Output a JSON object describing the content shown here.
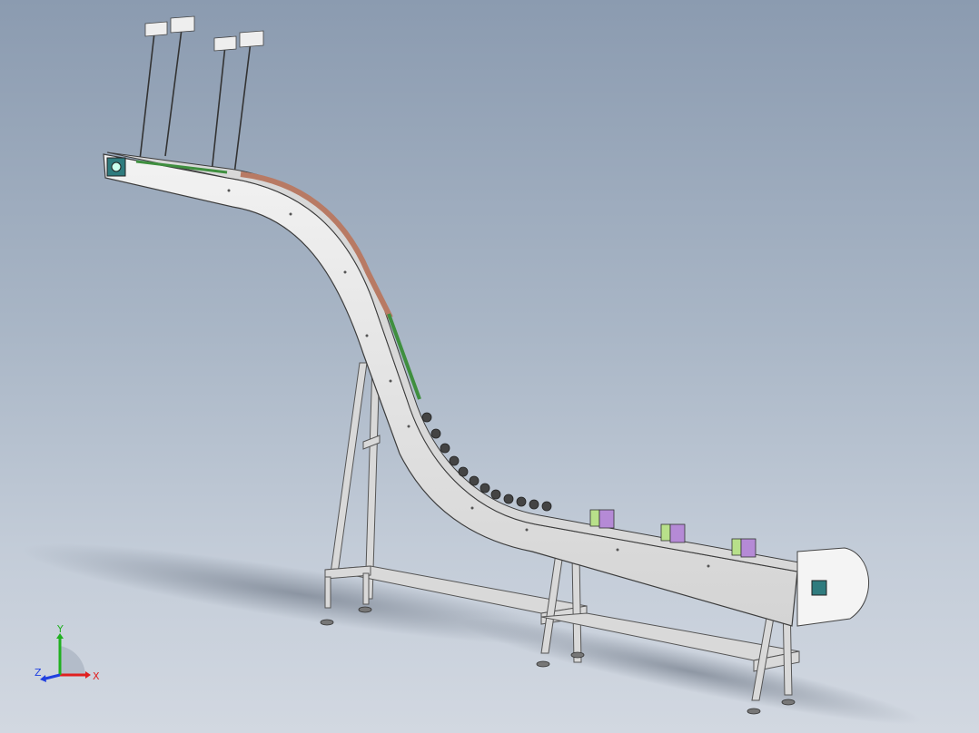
{
  "viewport": {
    "background_top": "#8b9bb0",
    "background_bottom": "#d2d8e1"
  },
  "model": {
    "frame_color": "#e6e6e6",
    "frame_edge_color": "#444444",
    "belt_color": "#b87a64",
    "guide_color": "#3f8f3f",
    "product_green": "#b8e08a",
    "product_purple": "#b58ad6",
    "motor_color": "#2f7b7e"
  },
  "triad": {
    "x_label": "X",
    "y_label": "Y",
    "z_label": "Z",
    "x_color": "#e02020",
    "y_color": "#20b020",
    "z_color": "#2040e0"
  }
}
